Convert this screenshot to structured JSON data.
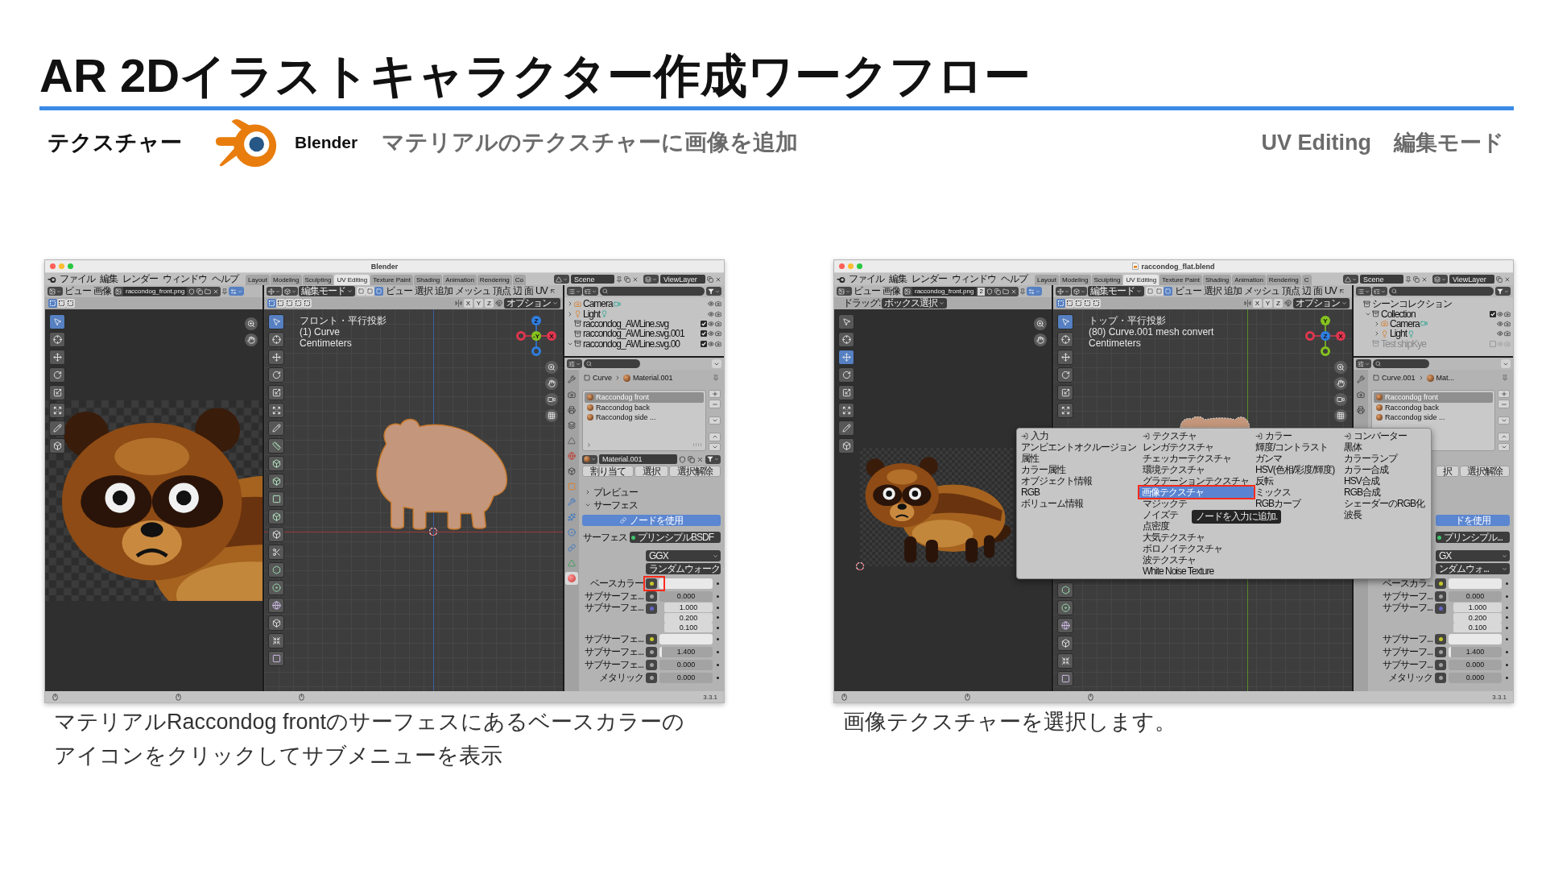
{
  "header": {
    "title": "AR 2Dイラストキャラクター作成ワークフロー",
    "section": "テクスチャー",
    "app": "Blender",
    "step": "マテリアルのテクスチャーに画像を追加",
    "workspace": "UV Editing",
    "mode": "編集モード"
  },
  "panels": [
    {
      "window": {
        "title": "Blender",
        "menus": [
          "ファイル",
          "編集",
          "レンダー",
          "ウィンドウ",
          "ヘルプ"
        ],
        "workspaces": [
          {
            "label": "Layout",
            "selected": false
          },
          {
            "label": "Modeling",
            "selected": false
          },
          {
            "label": "Sculpting",
            "selected": false
          },
          {
            "label": "UV Editing",
            "selected": true
          },
          {
            "label": "Texture Paint",
            "selected": false
          },
          {
            "label": "Shading",
            "selected": false
          },
          {
            "label": "Animation",
            "selected": false
          },
          {
            "label": "Rendering",
            "selected": false
          },
          {
            "label": "Co",
            "selected": false
          }
        ],
        "scene": "Scene",
        "view_layer": "ViewLayer",
        "image_editor": {
          "menus": [
            "ビュー",
            "画像"
          ],
          "image": "raccondog_front.png",
          "box_modes": [
            {
              "selected": true
            },
            {
              "selected": false
            },
            {
              "selected": false
            }
          ],
          "tools": [
            {
              "kind": "select",
              "selected": true
            },
            {
              "kind": "cursor",
              "selected": false
            },
            {
              "kind": "move",
              "selected": false
            },
            {
              "kind": "rotate",
              "selected": false
            },
            {
              "kind": "scale",
              "selected": false
            },
            {
              "kind": "transform",
              "selected": false
            },
            {
              "kind": "annotate",
              "selected": false
            },
            {
              "kind": "rip",
              "selected": false
            }
          ],
          "kind": "closeup"
        },
        "viewport": {
          "mode": "編集モード",
          "select_modes": [
            {
              "selected": false
            },
            {
              "selected": false
            },
            {
              "selected": true
            }
          ],
          "menus": [
            "ビュー",
            "選択",
            "追加",
            "メッシュ",
            "頂点",
            "辺",
            "面",
            "UV"
          ],
          "box_modes": [
            {
              "selected": true
            },
            {
              "selected": false
            },
            {
              "selected": false
            },
            {
              "selected": false
            },
            {
              "selected": false
            }
          ],
          "axes": [
            "X",
            "Y",
            "Z"
          ],
          "options": "オプション",
          "overlay": [
            "フロント・平行投影",
            "(1) Curve",
            "Centimeters"
          ],
          "gizmo": [
            {
              "label": "Z",
              "kind": "top",
              "color": "#2f7ee0"
            },
            {
              "label": "X",
              "kind": "right",
              "color": "#e0364f"
            },
            {
              "label": "-Y",
              "kind": "center",
              "color": "#86c41e"
            },
            {
              "kind": "left",
              "color": "#e0364f"
            },
            {
              "kind": "bottom",
              "color": "#2f7ee0"
            }
          ],
          "kind": "front",
          "cursor": true,
          "tools": [
            {
              "kind": "select",
              "selected": true
            },
            {
              "kind": "cursor",
              "selected": false
            },
            {
              "kind": "move",
              "selected": false
            },
            {
              "kind": "rotate",
              "selected": false
            },
            {
              "kind": "scale",
              "selected": false
            },
            {
              "kind": "transform",
              "selected": false
            },
            {
              "kind": "annotate",
              "selected": false
            },
            {
              "kind": "measure",
              "selected": false
            },
            {
              "kind": "add_cube",
              "selected": false
            },
            {
              "kind": "extrude",
              "selected": false
            },
            {
              "kind": "inset",
              "selected": false
            },
            {
              "kind": "bevel",
              "selected": false
            },
            {
              "kind": "loop_cut",
              "selected": false
            },
            {
              "kind": "knife",
              "selected": false
            },
            {
              "kind": "poly_build",
              "selected": false
            },
            {
              "kind": "spin",
              "selected": false
            },
            {
              "kind": "smooth",
              "selected": false
            },
            {
              "kind": "slide",
              "selected": false
            },
            {
              "kind": "shrink",
              "selected": false
            },
            {
              "kind": "shear",
              "selected": false
            }
          ]
        },
        "outliner": {
          "tree": [
            {
              "kind": "camera",
              "label": "Camera",
              "expanded": false
            },
            {
              "kind": "light",
              "label": "Light",
              "expanded": false
            },
            {
              "kind": "collection",
              "label": "raccondog_AWLine.svg",
              "checked": true
            },
            {
              "kind": "collection",
              "label": "raccondog_AWLine.svg.001",
              "checked": true
            },
            {
              "kind": "collection",
              "label": "raccondog_AWLine.svg.00",
              "expanded": true,
              "checked": true
            }
          ]
        },
        "properties": {
          "tabs": [
            {
              "kind": "tool",
              "selected": false
            },
            {
              "kind": "render",
              "selected": false
            },
            {
              "kind": "output",
              "selected": false
            },
            {
              "kind": "view_layer",
              "selected": false
            },
            {
              "kind": "scene",
              "selected": false
            },
            {
              "kind": "world",
              "selected": false
            },
            {
              "kind": "collection",
              "selected": false
            },
            {
              "kind": "object",
              "selected": false
            },
            {
              "kind": "modifiers",
              "selected": false
            },
            {
              "kind": "particles",
              "selected": false
            },
            {
              "kind": "physics",
              "selected": false
            },
            {
              "kind": "constraints",
              "selected": false
            },
            {
              "kind": "data",
              "selected": false
            },
            {
              "kind": "material",
              "selected": true
            }
          ],
          "breadcrumb": [
            "Curve",
            "Material.001"
          ],
          "slots": [
            {
              "label": "Raccondog front",
              "selected": true
            },
            {
              "label": "Raccondog back",
              "selected": false
            },
            {
              "label": "Raccondog side ...",
              "selected": false
            }
          ],
          "material": "Material.001",
          "slot_buttons": [
            "割り当て",
            "選択",
            "選択解除"
          ],
          "sections": [
            {
              "label": "プレビュー",
              "expanded": false
            },
            {
              "label": "サーフェス",
              "expanded": true
            }
          ],
          "use_nodes": "ノードを使用",
          "surface": {
            "label": "サーフェス",
            "value": "プリンシプルBSDF"
          },
          "dropdowns": [
            "GGX",
            "ランダムウォーク"
          ],
          "inputs": [
            {
              "label": "ベースカラー",
              "kind": "color",
              "highlighted": true
            },
            {
              "label": "サブサーフェ...",
              "kind": "number",
              "values": [
                "0.000"
              ],
              "highlighted": false
            },
            {
              "label": "サブサーフェ...",
              "kind": "vector",
              "values": [
                "1.000",
                "0.200",
                "0.100"
              ],
              "highlighted": false
            },
            {
              "label": "サブサーフェ...",
              "kind": "color",
              "highlighted": false
            },
            {
              "label": "サブサーフェ...",
              "kind": "number",
              "values": [
                "1.400"
              ],
              "level": 0.05,
              "highlighted": false
            },
            {
              "label": "サブサーフェ...",
              "kind": "number",
              "values": [
                "0.000"
              ],
              "highlighted": false
            },
            {
              "label": "メタリック",
              "kind": "number",
              "values": [
                "0.000"
              ],
              "highlighted": false
            }
          ]
        },
        "version": "3.3.1"
      },
      "caption": "マテリアルRaccondog frontのサーフェスにあるベースカラーのアイコンをクリックしてサブメニューを表示"
    },
    {
      "window": {
        "title": "raccondog_flat.blend",
        "file_icon": true,
        "menus": [
          "ファイル",
          "編集",
          "レンダー",
          "ウィンドウ",
          "ヘルプ"
        ],
        "workspaces": [
          {
            "label": "Layout",
            "selected": false
          },
          {
            "label": "Modeling",
            "selected": false
          },
          {
            "label": "Sculpting",
            "selected": false
          },
          {
            "label": "UV Editing",
            "selected": true
          },
          {
            "label": "Texture Paint",
            "selected": false
          },
          {
            "label": "Shading",
            "selected": false
          },
          {
            "label": "Animation",
            "selected": false
          },
          {
            "label": "Rendering",
            "selected": false
          },
          {
            "label": "C",
            "selected": false
          }
        ],
        "scene": "Scene",
        "view_layer": "ViewLayer",
        "image_editor": {
          "menus": [
            "ビュー",
            "画像"
          ],
          "image": "raccondog_front.png",
          "users": "2",
          "tool_setting": {
            "label": "ドラッグ:",
            "value": "ボックス選択"
          },
          "tools": [
            {
              "kind": "select",
              "selected": false
            },
            {
              "kind": "cursor",
              "selected": false
            },
            {
              "kind": "move",
              "selected": true
            },
            {
              "kind": "rotate",
              "selected": false
            },
            {
              "kind": "scale",
              "selected": false
            },
            {
              "kind": "transform",
              "selected": false
            },
            {
              "kind": "annotate",
              "selected": false
            },
            {
              "kind": "rip",
              "selected": false
            }
          ],
          "kind": "full",
          "cursor": true
        },
        "viewport": {
          "mode": "編集モード",
          "select_modes": [
            {
              "selected": false
            },
            {
              "selected": false
            },
            {
              "selected": true
            }
          ],
          "menus": [
            "ビュー",
            "選択",
            "追加",
            "メッシュ",
            "頂点",
            "辺",
            "面",
            "UV"
          ],
          "box_modes": [
            {
              "selected": true
            },
            {
              "selected": false
            },
            {
              "selected": false
            },
            {
              "selected": false
            },
            {
              "selected": false
            }
          ],
          "axes": [
            "X",
            "Y",
            "Z"
          ],
          "options": "オプション",
          "overlay": [
            "トップ・平行投影",
            "(80) Curve.001 mesh convert",
            "Centimeters"
          ],
          "gizmo": [
            {
              "label": "Y",
              "kind": "top",
              "color": "#86c41e"
            },
            {
              "label": "X",
              "kind": "right",
              "color": "#e0364f"
            },
            {
              "label": "Z",
              "kind": "center",
              "color": "#2f7ee0"
            },
            {
              "kind": "left",
              "color": "#e0364f"
            },
            {
              "kind": "bottom",
              "color": "#86c41e"
            }
          ],
          "kind": "top",
          "tools": [
            {
              "kind": "select",
              "selected": true
            },
            {
              "kind": "cursor",
              "selected": false
            },
            {
              "kind": "move",
              "selected": false
            },
            {
              "kind": "rotate",
              "selected": false
            },
            {
              "kind": "scale",
              "selected": false
            },
            {
              "kind": "transform",
              "selected": false
            }
          ],
          "lower_tools": [
            {
              "kind": "poly_build",
              "selected": false
            },
            {
              "kind": "spin",
              "selected": false
            },
            {
              "kind": "smooth",
              "selected": false
            },
            {
              "kind": "slide",
              "selected": false
            },
            {
              "kind": "shrink",
              "selected": false
            },
            {
              "kind": "shear",
              "selected": false
            }
          ]
        },
        "outliner": {
          "tree": [
            {
              "kind": "scene",
              "label": "シーンコレクション",
              "children": [
                {
                  "kind": "collection",
                  "label": "Collection",
                  "expanded": true,
                  "checked": true,
                  "children": [
                    {
                      "kind": "camera",
                      "label": "Camera",
                      "expanded": false
                    },
                    {
                      "kind": "light",
                      "label": "Light",
                      "expanded": false
                    }
                  ]
                },
                {
                  "kind": "collection",
                  "label": "Test shipKye",
                  "checked": false
                }
              ]
            }
          ]
        },
        "properties": {
          "tabs": [
            {
              "kind": "tool",
              "selected": false
            },
            {
              "kind": "render",
              "selected": false
            },
            {
              "kind": "output",
              "selected": false
            }
          ],
          "breadcrumb": [
            "Curve.001",
            "Mat..."
          ],
          "slots": [
            {
              "label": "Raccondog front",
              "selected": true
            },
            {
              "label": "Raccondog back",
              "selected": false
            },
            {
              "label": "Raccondog side ...",
              "selected": false
            }
          ],
          "slot_buttons": [
            "択",
            "選択解除"
          ],
          "use_nodes": "ドを使用",
          "surface": {
            "value": "プリンシプル..."
          },
          "dropdowns": [
            "GX",
            "ンダムウォ..."
          ],
          "inputs": [
            {
              "label": "ベースカラ...",
              "kind": "color",
              "highlighted": false
            },
            {
              "label": "サブサーフ...",
              "kind": "number",
              "values": [
                "0.000"
              ],
              "highlighted": false
            },
            {
              "label": "サブサーフ...",
              "kind": "vector",
              "values": [
                "1.000",
                "0.200",
                "0.100"
              ],
              "highlighted": false
            },
            {
              "label": "サブサーフ...",
              "kind": "color",
              "highlighted": false
            },
            {
              "label": "サブサーフ...",
              "kind": "number",
              "values": [
                "1.400"
              ],
              "level": 0.05,
              "highlighted": false
            },
            {
              "label": "サブサーフ...",
              "kind": "number",
              "values": [
                "0.000"
              ],
              "highlighted": false
            },
            {
              "label": "メタリック",
              "kind": "number",
              "values": [
                "0.000"
              ],
              "highlighted": false
            }
          ]
        },
        "add_menu": {
          "columns": [
            {
              "title": "入力",
              "items": [
                {
                  "label": "アンビエントオクルージョン",
                  "selected": false,
                  "highlighted": false
                },
                {
                  "label": "属性",
                  "selected": false,
                  "highlighted": false
                },
                {
                  "label": "カラー属性",
                  "selected": false,
                  "highlighted": false
                },
                {
                  "label": "オブジェクト情報",
                  "selected": false,
                  "highlighted": false
                },
                {
                  "label": "RGB",
                  "selected": false,
                  "highlighted": false
                },
                {
                  "label": "ボリューム情報",
                  "selected": false,
                  "highlighted": false
                }
              ]
            },
            {
              "title": "テクスチャ",
              "items": [
                {
                  "label": "レンガテクスチャ",
                  "selected": false,
                  "highlighted": false
                },
                {
                  "label": "チェッカーテクスチャ",
                  "selected": false,
                  "highlighted": false
                },
                {
                  "label": "環境テクスチャ",
                  "selected": false,
                  "highlighted": false
                },
                {
                  "label": "グラデーションテクスチャ",
                  "selected": false,
                  "highlighted": false
                },
                {
                  "label": "画像テクスチャ",
                  "selected": true,
                  "highlighted": true
                },
                {
                  "label": "マジックテ",
                  "selected": false,
                  "highlighted": false
                },
                {
                  "label": "ノイズテ",
                  "selected": false,
                  "highlighted": false
                },
                {
                  "label": "点密度",
                  "selected": false,
                  "highlighted": false
                },
                {
                  "label": "大気テクスチャ",
                  "selected": false,
                  "highlighted": false
                },
                {
                  "label": "ボロノイテクスチャ",
                  "selected": false,
                  "highlighted": false
                },
                {
                  "label": "波テクスチャ",
                  "selected": false,
                  "highlighted": false
                },
                {
                  "label": "White Noise Texture",
                  "selected": false,
                  "highlighted": false
                }
              ]
            },
            {
              "title": "カラー",
              "items": [
                {
                  "label": "輝度/コントラスト",
                  "selected": false,
                  "highlighted": false
                },
                {
                  "label": "ガンマ",
                  "selected": false,
                  "highlighted": false
                },
                {
                  "label": "HSV(色相/彩度/輝度)",
                  "selected": false,
                  "highlighted": false
                },
                {
                  "label": "反転",
                  "selected": false,
                  "highlighted": false
                },
                {
                  "label": "ミックス",
                  "selected": false,
                  "highlighted": false
                },
                {
                  "label": "RGBカーブ",
                  "selected": false,
                  "highlighted": false
                }
              ]
            },
            {
              "title": "コンバーター",
              "items": [
                {
                  "label": "黒体",
                  "selected": false,
                  "highlighted": false
                },
                {
                  "label": "カラーランプ",
                  "selected": false,
                  "highlighted": false
                },
                {
                  "label": "カラー合成",
                  "selected": false,
                  "highlighted": false
                },
                {
                  "label": "HSV合成",
                  "selected": false,
                  "highlighted": false
                },
                {
                  "label": "RGB合成",
                  "selected": false,
                  "highlighted": false
                },
                {
                  "label": "シェーダーのRGB化",
                  "selected": false,
                  "highlighted": false
                },
                {
                  "label": "波長",
                  "selected": false,
                  "highlighted": false
                }
              ]
            }
          ],
          "tooltip": "ノードを入力に追加."
        },
        "version": "3.3.1"
      },
      "caption": "画像テクスチャーを選択します。"
    }
  ]
}
